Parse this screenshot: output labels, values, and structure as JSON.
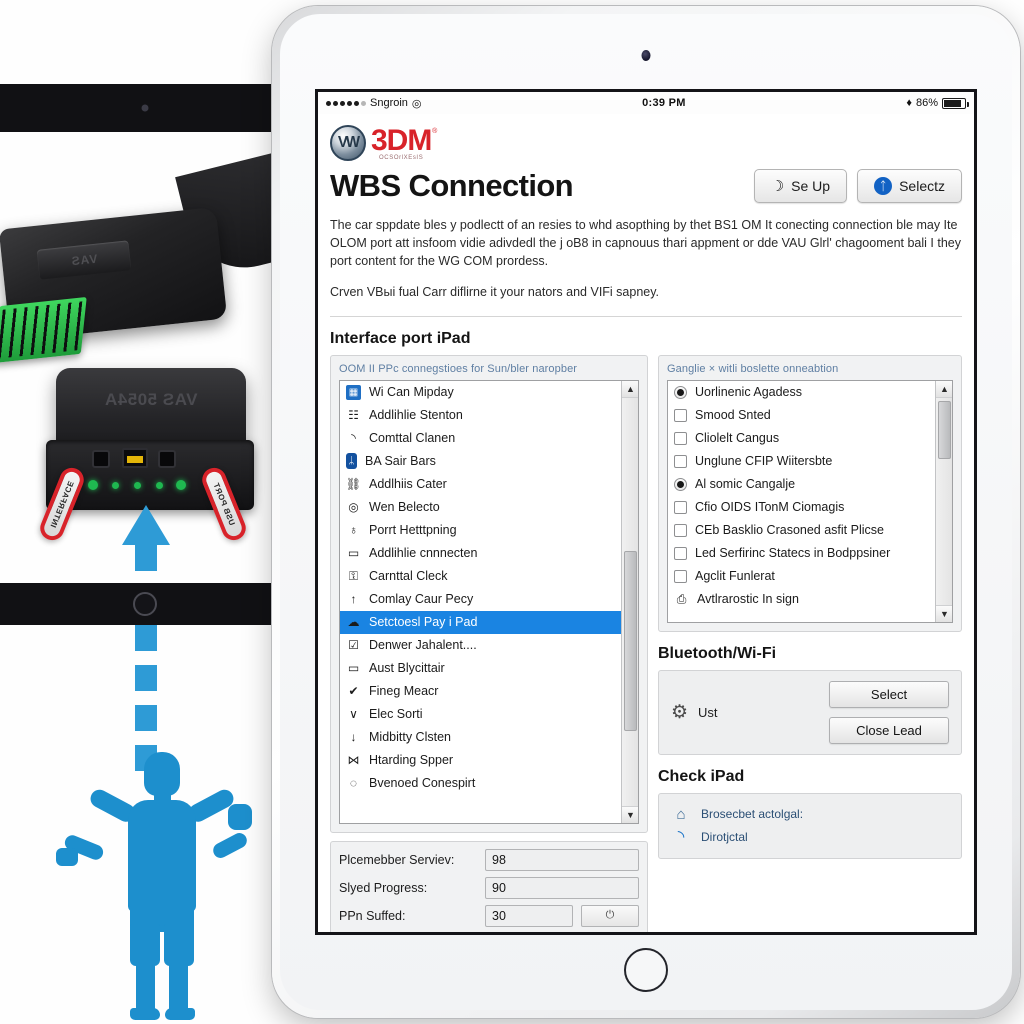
{
  "device": {
    "status_bar": {
      "carrier": "Sngroin",
      "time": "0:39 PM",
      "battery": "86%",
      "wifi_icon": "wifi-icon",
      "signal_icon": "signal-dots-icon"
    }
  },
  "brand": {
    "vw_logo": "VW",
    "mmm_logo": "3DM",
    "mmm_sub": "OCSOrlXEsIS",
    "trademark": "®"
  },
  "header": {
    "title": "WBS Connection",
    "buttons": [
      {
        "label": "Se Up",
        "icon": "moon-icon"
      },
      {
        "label": "Selectz",
        "icon": "bluetooth-icon"
      }
    ]
  },
  "intro": {
    "paragraph1": "The car sppdate bles y podlectt of an resies to whd asopthing by thet BS1 OM It conecting connection ble may Ite OLOM port att insfoom vidie adivdedl the j oB8 in capnouus thari appment or dde VAU Glrl' chagooment bali I they port content for the WG COM prordess.",
    "paragraph2": "Crven VBыі fual Carr diflirne it your nators and VIFi sapney."
  },
  "interface_section": {
    "title": "Interface port iPad",
    "left_panel_label": "OOM II PPc connegstioes for Sun/bler naropber",
    "right_panel_label": "Ganglie × witli boslette onneabtion"
  },
  "left_list": {
    "items": [
      {
        "label": "Wi Can Mipday",
        "icon": "image-tile-icon",
        "icon_style": "blue"
      },
      {
        "label": "Addlihlie Stenton",
        "icon": "table-icon",
        "icon_style": "plain"
      },
      {
        "label": "Comttal Clanen",
        "icon": "wifi-icon",
        "icon_style": "plain"
      },
      {
        "label": "BA Sair Bars",
        "icon": "bluetooth-icon",
        "icon_style": "bt"
      },
      {
        "label": "Addlhiis Cater",
        "icon": "network-tree-icon",
        "icon_style": "plain"
      },
      {
        "label": "Wen Belecto",
        "icon": "target-icon",
        "icon_style": "plain"
      },
      {
        "label": "Porrt Hetttpning",
        "icon": "trophy-icon",
        "icon_style": "plain"
      },
      {
        "label": "Addlihlie cnnnecten",
        "icon": "monitor-icon",
        "icon_style": "plain"
      },
      {
        "label": "Carnttal Cleck",
        "icon": "lock-icon",
        "icon_style": "plain"
      },
      {
        "label": "Comlay Caur Pecy",
        "icon": "arrow-up-icon",
        "icon_style": "plain"
      },
      {
        "label": "Setctoesl Pay i Pad",
        "icon": "cloud-icon",
        "icon_style": "plain",
        "selected": true
      },
      {
        "label": "Denwer Jahalent....",
        "icon": "checkbox-icon",
        "icon_style": "plain"
      },
      {
        "label": "Aust Blycittair",
        "icon": "monitor-icon",
        "icon_style": "plain"
      },
      {
        "label": "Fineg Meacr",
        "icon": "check-bold-icon",
        "icon_style": "plain"
      },
      {
        "label": "Elec Sorti",
        "icon": "chevron-down-icon",
        "icon_style": "plain"
      },
      {
        "label": "Midbitty Clsten",
        "icon": "arrow-down-icon",
        "icon_style": "plain"
      },
      {
        "label": "Htarding Spper",
        "icon": "bowtie-icon",
        "icon_style": "plain"
      },
      {
        "label": "Bvenoed Conespirt",
        "icon": "circle-icon",
        "icon_style": "plain"
      }
    ]
  },
  "right_list": {
    "items": [
      {
        "label": "Uorlinenic Agadess",
        "checked": true,
        "type": "radio"
      },
      {
        "label": "Smood Snted",
        "checked": false,
        "type": "checkbox"
      },
      {
        "label": "Cliolelt Cangus",
        "checked": false,
        "type": "checkbox"
      },
      {
        "label": "Unglune CFIP Wiitersbte",
        "checked": false,
        "type": "checkbox"
      },
      {
        "label": "Al somic Cangalje",
        "checked": true,
        "type": "radio"
      },
      {
        "label": "Cfio OIDS ITonM Ciomagis",
        "checked": false,
        "type": "checkbox"
      },
      {
        "label": "CEb Basklio Crasoned asfit Plicse",
        "checked": false,
        "type": "checkbox"
      },
      {
        "label": "Led Serfirinc Statecs in Bodppsiner",
        "checked": false,
        "type": "checkbox"
      },
      {
        "label": "Agclit Funlerat",
        "checked": false,
        "type": "checkbox"
      },
      {
        "label": "Avtlrarostic In sign",
        "checked": false,
        "type": "printer"
      }
    ]
  },
  "fields": [
    {
      "label": "Plcemebber Serviev:",
      "value": "98"
    },
    {
      "label": "Slyed Progress:",
      "value": "90"
    },
    {
      "label": "PPn Suffed:",
      "value": "30",
      "button_icon": "power-icon"
    }
  ],
  "bluetooth_section": {
    "title": "Bluetooth/Wi-Fi",
    "item_label": "Ust",
    "item_icon": "link-gear-icon",
    "buttons": [
      {
        "label": "Select"
      },
      {
        "label": "Close Lead"
      }
    ]
  },
  "check_section": {
    "title": "Check iPad",
    "rows": [
      {
        "label": "Brosecbet actolgal:",
        "icon": "bank-icon"
      },
      {
        "label": "Dirotjctal",
        "icon": "wifi-icon"
      }
    ]
  },
  "hardware": {
    "plug_emboss": "VAS",
    "vas_brand": "VAS 5054A",
    "callout_left": "INTERFACE",
    "callout_right": "USB PORT"
  },
  "colors": {
    "accent_blue": "#1a84e2",
    "brand_red": "#d8232a",
    "panel_grey": "#f1f2f3",
    "label_blue": "#5f7fa3",
    "silhouette_blue": "#1d8fcd"
  }
}
